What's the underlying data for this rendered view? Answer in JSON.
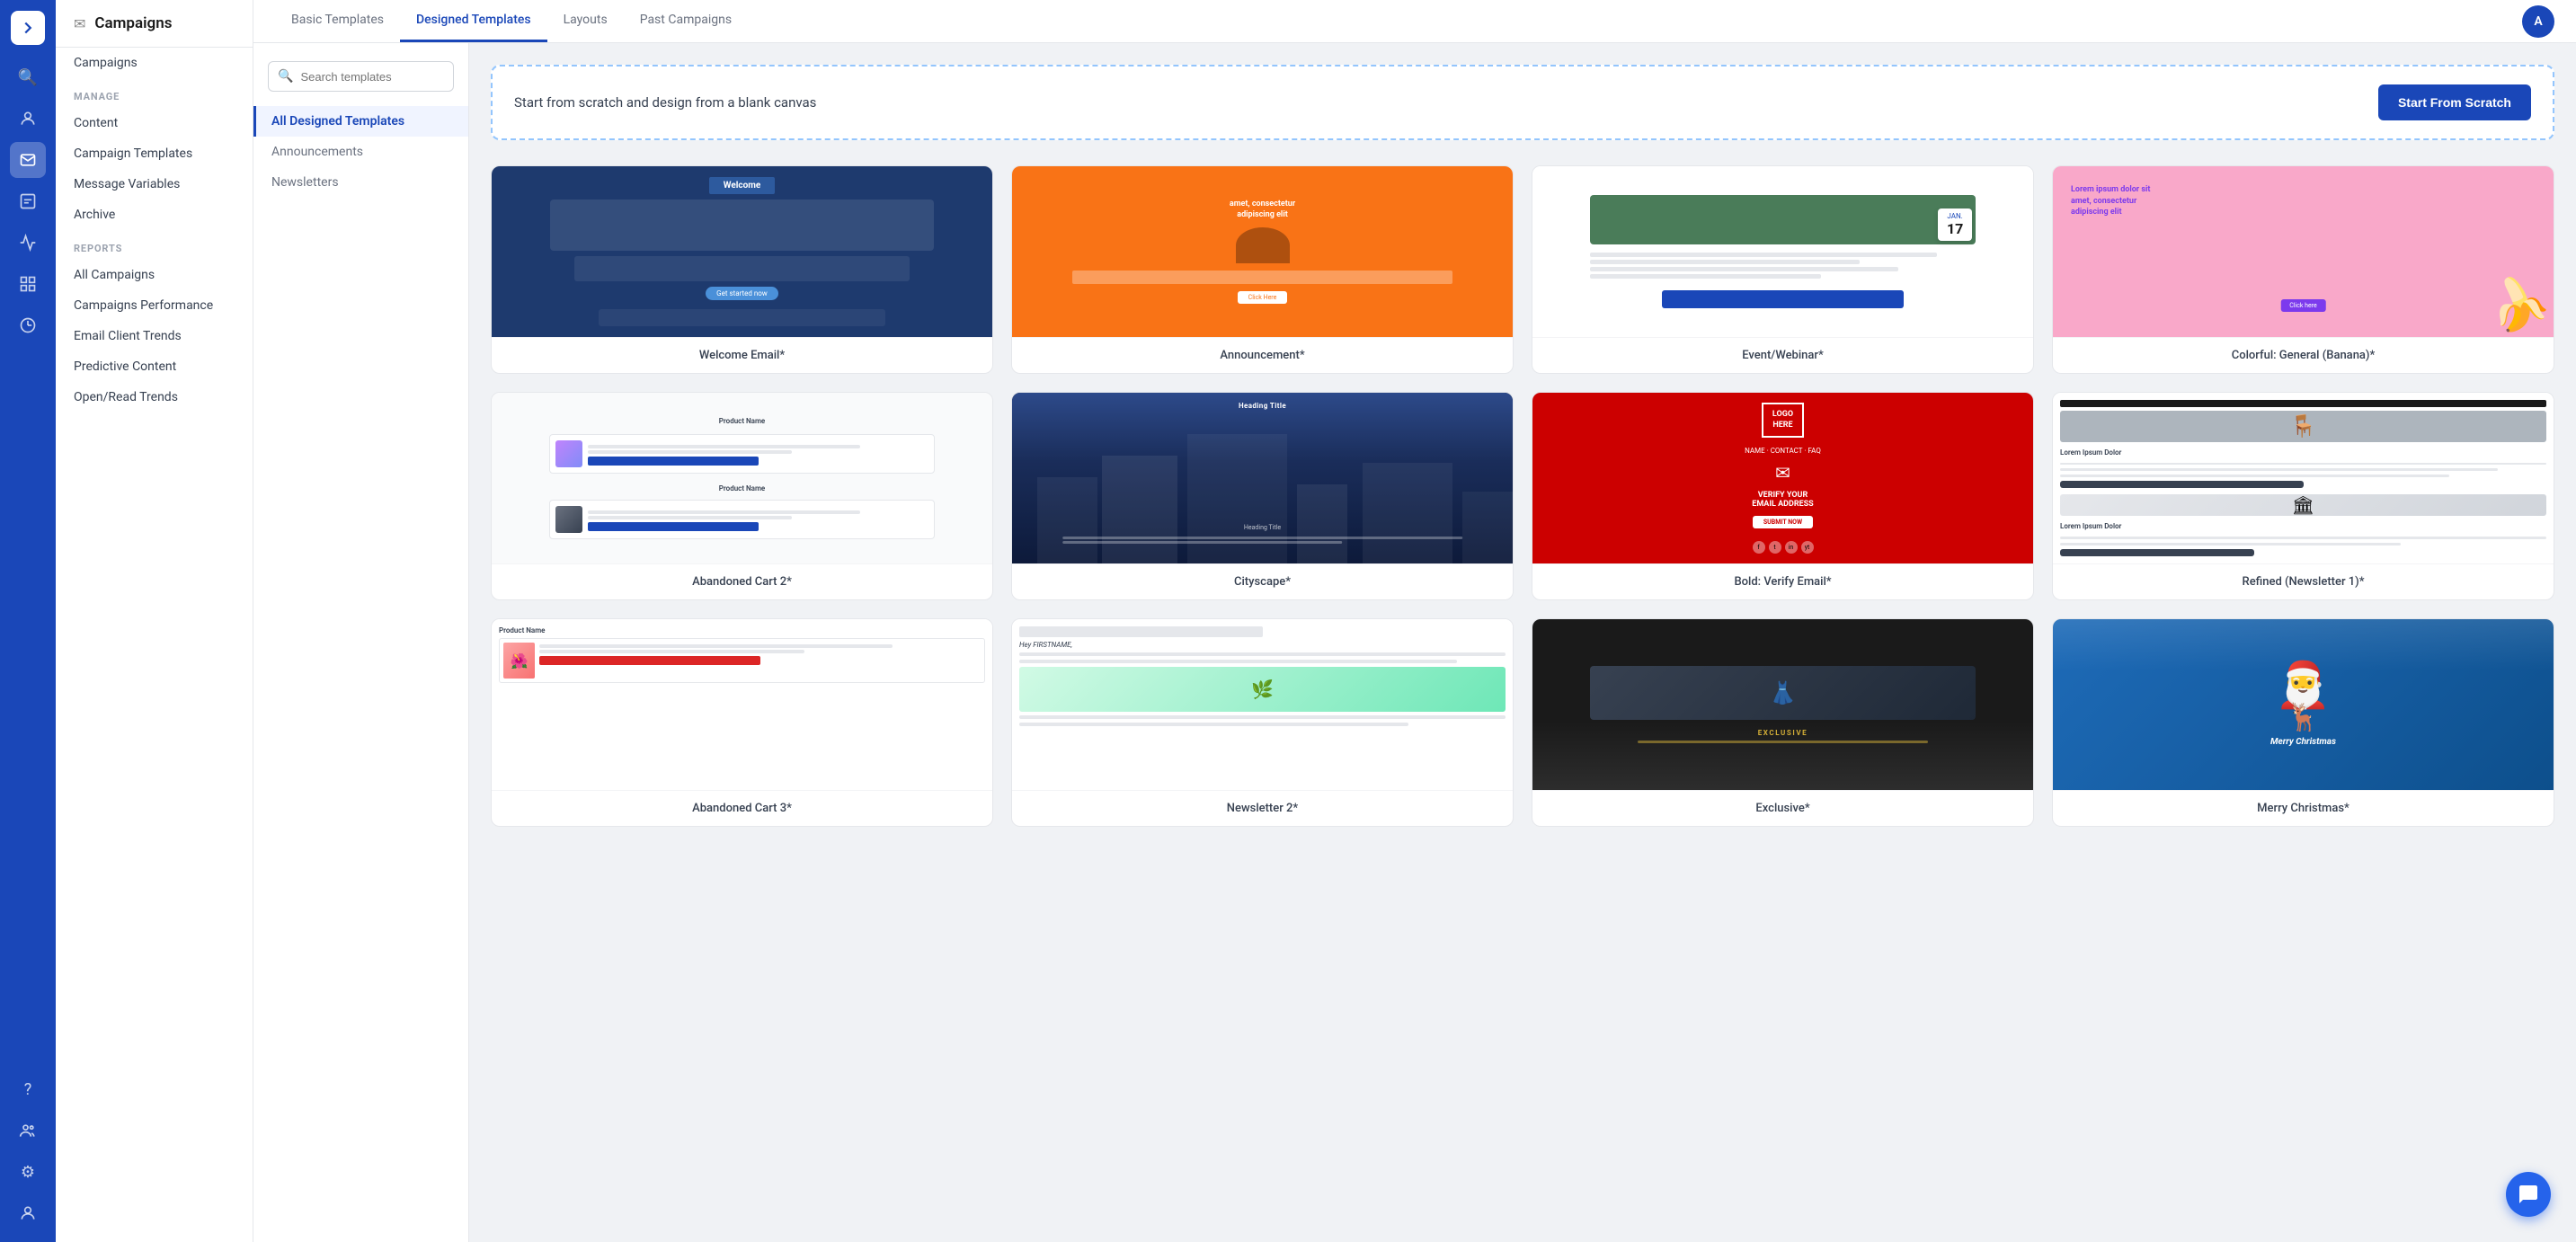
{
  "app": {
    "title": "Campaigns"
  },
  "iconRail": {
    "items": [
      {
        "name": "expand-icon",
        "icon": "❯",
        "active": false
      },
      {
        "name": "search-icon",
        "icon": "🔍",
        "active": false
      },
      {
        "name": "person-icon",
        "icon": "👤",
        "active": false
      },
      {
        "name": "email-icon",
        "icon": "✉",
        "active": true
      },
      {
        "name": "chart-bar-icon",
        "icon": "▦",
        "active": false
      },
      {
        "name": "chart-line-icon",
        "icon": "📊",
        "active": false
      },
      {
        "name": "grid-icon",
        "icon": "⊞",
        "active": false
      },
      {
        "name": "pie-icon",
        "icon": "◕",
        "active": false
      }
    ],
    "bottomItems": [
      {
        "name": "question-icon",
        "icon": "?"
      },
      {
        "name": "add-user-icon",
        "icon": "👥"
      },
      {
        "name": "settings-icon",
        "icon": "⚙"
      },
      {
        "name": "user-icon",
        "icon": "👤"
      }
    ]
  },
  "nav": {
    "header": {
      "title": "Campaigns",
      "icon": "✉"
    },
    "topItem": {
      "label": "Campaigns"
    },
    "sections": [
      {
        "label": "MANAGE",
        "items": [
          "Content",
          "Campaign Templates",
          "Message Variables",
          "Archive"
        ]
      },
      {
        "label": "REPORTS",
        "items": [
          "All Campaigns",
          "Campaigns Performance",
          "Email Client Trends",
          "Predictive Content",
          "Open/Read Trends"
        ]
      }
    ]
  },
  "tabs": {
    "items": [
      {
        "label": "Basic Templates",
        "active": false
      },
      {
        "label": "Designed Templates",
        "active": true
      },
      {
        "label": "Layouts",
        "active": false
      },
      {
        "label": "Past Campaigns",
        "active": false
      }
    ]
  },
  "filterPanel": {
    "search": {
      "placeholder": "Search templates"
    },
    "filters": [
      {
        "label": "All Designed Templates",
        "active": true
      },
      {
        "label": "Announcements",
        "active": false
      },
      {
        "label": "Newsletters",
        "active": false
      }
    ]
  },
  "scratchBanner": {
    "text": "Start from scratch and design from a blank canvas",
    "buttonLabel": "Start From Scratch"
  },
  "templates": {
    "items": [
      {
        "label": "Welcome Email*",
        "thumb": "welcome"
      },
      {
        "label": "Announcement*",
        "thumb": "announcement"
      },
      {
        "label": "Event/Webinar*",
        "thumb": "event"
      },
      {
        "label": "Colorful: General (Banana)*",
        "thumb": "banana"
      },
      {
        "label": "Abandoned Cart 2*",
        "thumb": "cart"
      },
      {
        "label": "Cityscape*",
        "thumb": "cityscape"
      },
      {
        "label": "Bold: Verify Email*",
        "thumb": "verify"
      },
      {
        "label": "Refined (Newsletter 1)*",
        "thumb": "newsletter"
      },
      {
        "label": "Abandoned Cart 3*",
        "thumb": "cart2"
      },
      {
        "label": "Newsletter 2*",
        "thumb": "newsletter2"
      },
      {
        "label": "Exclusive*",
        "thumb": "exclusive"
      },
      {
        "label": "Merry Christmas*",
        "thumb": "christmas"
      }
    ]
  }
}
